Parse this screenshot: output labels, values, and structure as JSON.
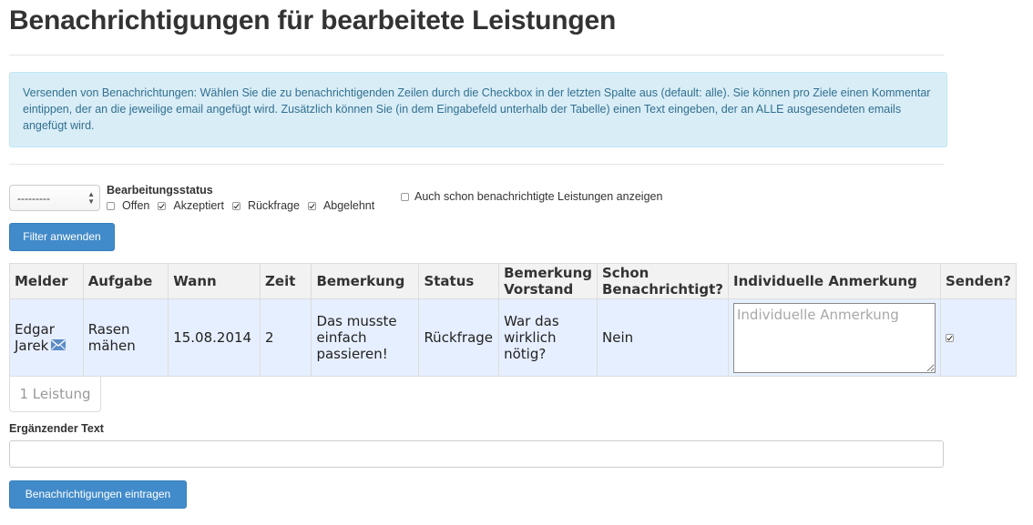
{
  "page": {
    "title": "Benachrichtigungen für bearbeitete Leistungen",
    "info": "Versenden von Benachrichtungen: Wählen Sie die zu benachrichtigenden Zeilen durch die Checkbox in der letzten Spalte aus (default: alle). Sie können pro Ziele einen Kommentar eintippen, der an die jeweilige email angefügt wird. Zusätzlich können Sie (in dem Eingabefeld unterhalb der Tabelle) einen Text eingeben, der an ALLE ausgesendeten emails angefügt wird."
  },
  "filter": {
    "select_value": "---------",
    "status_label": "Bearbeitungsstatus",
    "statuses": [
      {
        "label": "Offen",
        "checked": false
      },
      {
        "label": "Akzeptiert",
        "checked": true
      },
      {
        "label": "Rückfrage",
        "checked": true
      },
      {
        "label": "Abgelehnt",
        "checked": true
      }
    ],
    "also_notified_label": "Auch schon benachrichtigte Leistungen anzeigen",
    "also_notified_checked": false,
    "apply_button": "Filter anwenden"
  },
  "table": {
    "headers": [
      "Melder",
      "Aufgabe",
      "Wann",
      "Zeit",
      "Bemerkung",
      "Status",
      "Bemerkung Vorstand",
      "Schon Benachrichtigt?",
      "Individuelle Anmerkung",
      "Senden?"
    ],
    "rows": [
      {
        "melder": "Edgar Jarek",
        "melder_icon": "envelope-icon",
        "aufgabe": "Rasen mähen",
        "wann": "15.08.2014",
        "zeit": "2",
        "bemerkung": "Das musste einfach passieren!",
        "status": "Rückfrage",
        "bemerkung_vorstand": "War das wirklich nötig?",
        "schon_benachrichtigt": "Nein",
        "anmerkung_placeholder": "Individuelle Anmerkung",
        "senden": true
      }
    ],
    "count_label": "1 Leistung"
  },
  "extra": {
    "label": "Ergänzender Text",
    "value": "",
    "submit_button": "Benachrichtigungen eintragen"
  },
  "colors": {
    "primary": "#428bca",
    "info_bg": "#d9edf7",
    "info_text": "#31708f",
    "row_bg": "#e6efff"
  }
}
